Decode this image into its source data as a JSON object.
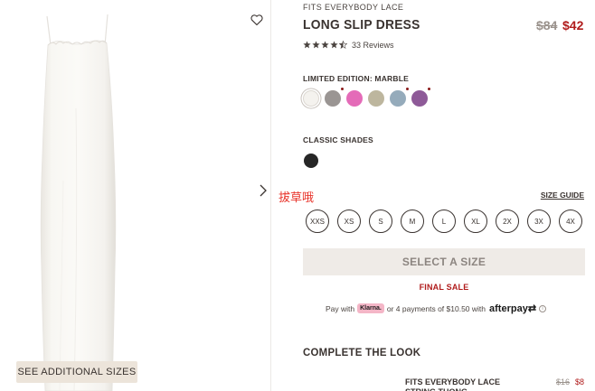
{
  "gallery": {
    "see_sizes_label": "SEE ADDITIONAL SIZES",
    "wishlist_icon": "heart-icon",
    "next_icon": "chevron-right-icon"
  },
  "product": {
    "brand": "FITS EVERYBODY LACE",
    "title": "LONG SLIP DRESS",
    "price_old": "$84",
    "price_new": "$42",
    "rating": 4.5,
    "reviews": "33 Reviews"
  },
  "colors": {
    "limited_label": "LIMITED EDITION: MARBLE",
    "limited": [
      {
        "name": "Marble",
        "hex": "#f4f2ee",
        "new": false
      },
      {
        "name": "Gray",
        "hex": "#9a9593",
        "new": true
      },
      {
        "name": "Pink",
        "hex": "#e46bb8",
        "new": false
      },
      {
        "name": "Sage",
        "hex": "#bdb69e",
        "new": false
      },
      {
        "name": "Blue",
        "hex": "#95abbb",
        "new": true
      },
      {
        "name": "Purple",
        "hex": "#8e5a98",
        "new": true
      }
    ],
    "classic_label": "CLASSIC SHADES",
    "classic": [
      {
        "name": "Onyx",
        "hex": "#262626"
      }
    ]
  },
  "overlay_text": "拔草哦",
  "size": {
    "guide": "SIZE GUIDE",
    "options": [
      "XXS",
      "XS",
      "S",
      "M",
      "L",
      "XL",
      "2X",
      "3X",
      "4X"
    ]
  },
  "cta": {
    "select_size": "SELECT A SIZE",
    "final_sale": "FINAL SALE"
  },
  "payment": {
    "pay_with": "Pay with",
    "klarna": "Klarna.",
    "installments": "or 4 payments of $10.50 with",
    "afterpay": "afterpay"
  },
  "complete_look": {
    "title": "COMPLETE THE LOOK",
    "item_name": "FITS EVERYBODY LACE STRING THONG",
    "item_price_old": "$16",
    "item_price_new": "$8"
  }
}
